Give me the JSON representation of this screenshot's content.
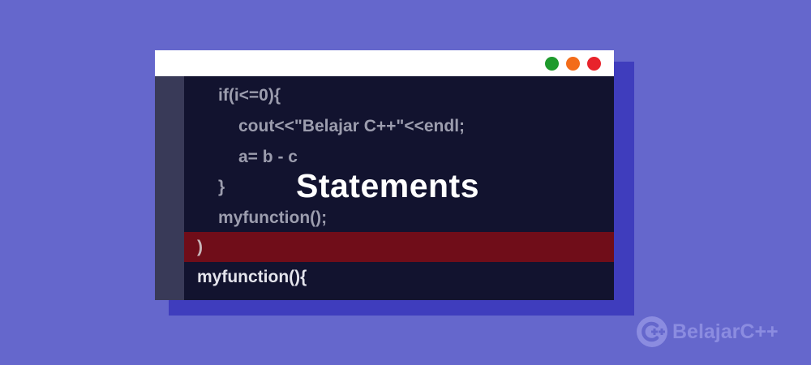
{
  "code_window": {
    "controls": {
      "green": "#1e9a2c",
      "orange": "#f36c1a",
      "red": "#e8232b"
    },
    "lines": [
      "if(i<=0){",
      "cout<<\"Belajar C++\"<<endl;",
      "a= b - c",
      "}",
      "myfunction();",
      ")",
      "myfunction(){"
    ],
    "highlight_color": "#700d19"
  },
  "overlay_title": "Statements",
  "brand": {
    "name": "BelajarC++",
    "icon": "cpp-logo-icon"
  },
  "colors": {
    "background": "#6567cc",
    "shadow": "#3f3dbd",
    "editor_bg": "#12132f",
    "gutter": "#393a58"
  }
}
